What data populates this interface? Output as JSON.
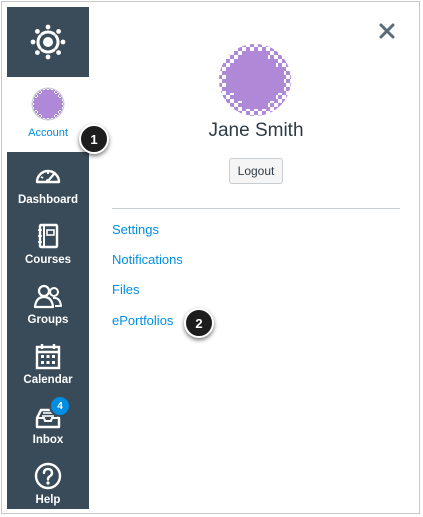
{
  "sidebar": {
    "logo_name": "canvas-logo",
    "account": {
      "label": "Account"
    },
    "items": [
      {
        "label": "Dashboard",
        "icon": "dashboard-icon"
      },
      {
        "label": "Courses",
        "icon": "courses-icon"
      },
      {
        "label": "Groups",
        "icon": "groups-icon"
      },
      {
        "label": "Calendar",
        "icon": "calendar-icon"
      },
      {
        "label": "Inbox",
        "icon": "inbox-icon",
        "badge": "4"
      },
      {
        "label": "Help",
        "icon": "help-icon"
      }
    ]
  },
  "tray": {
    "user_name": "Jane Smith",
    "logout_label": "Logout",
    "links": [
      {
        "label": "Settings"
      },
      {
        "label": "Notifications"
      },
      {
        "label": "Files"
      },
      {
        "label": "ePortfolios"
      }
    ]
  },
  "callouts": [
    "1",
    "2"
  ],
  "colors": {
    "sidebar_bg": "#394b58",
    "accent": "#008ee2",
    "avatar_purple": "#b088d8",
    "text_dark": "#2d3b45"
  }
}
